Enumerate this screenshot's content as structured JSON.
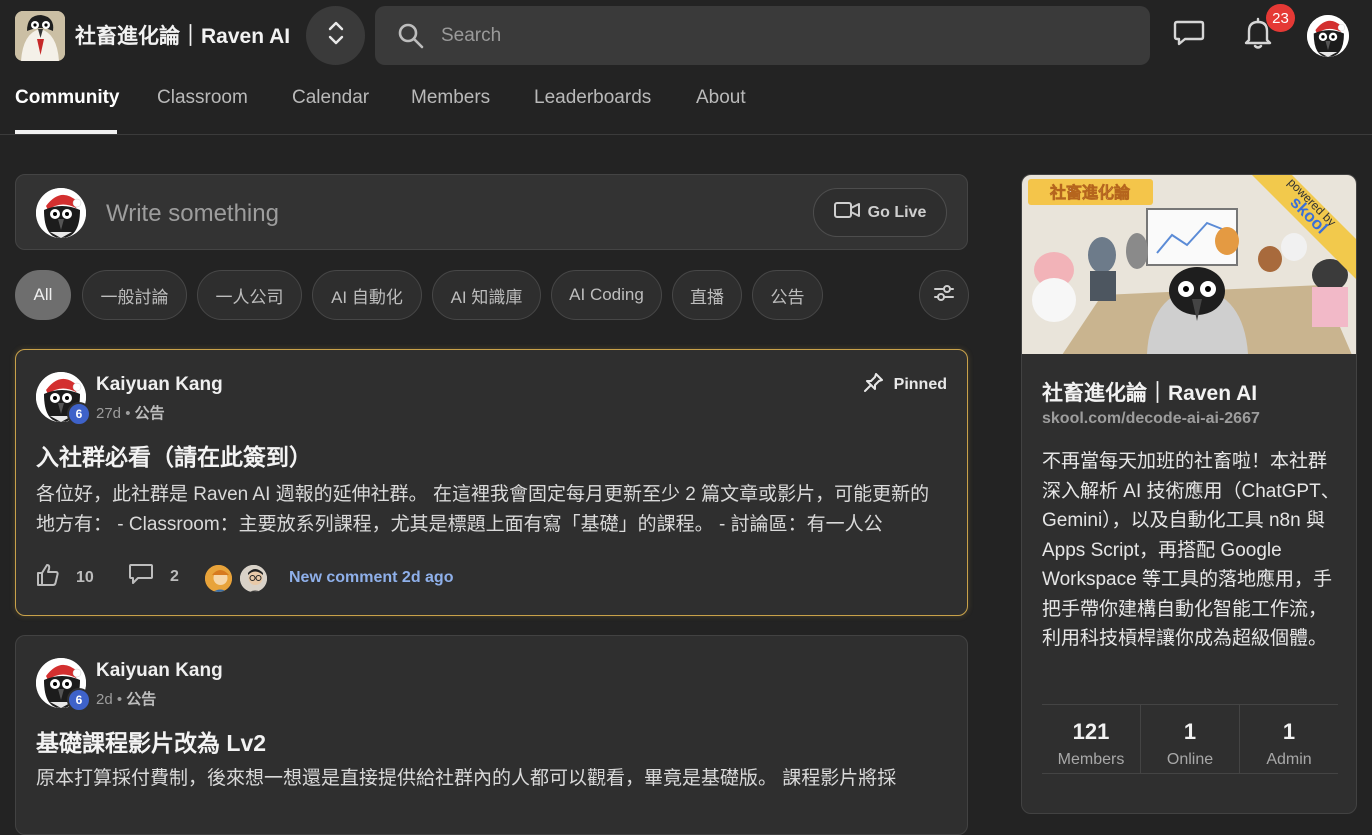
{
  "header": {
    "brand": "社畜進化論｜Raven AI",
    "search_placeholder": "Search",
    "notification_count": "23"
  },
  "nav": {
    "tabs": [
      {
        "label": "Community",
        "active": true
      },
      {
        "label": "Classroom"
      },
      {
        "label": "Calendar"
      },
      {
        "label": "Members"
      },
      {
        "label": "Leaderboards"
      },
      {
        "label": "About"
      }
    ]
  },
  "composer": {
    "placeholder": "Write something",
    "go_live_label": "Go Live"
  },
  "filters": {
    "chips": [
      "All",
      "一般討論",
      "一人公司",
      "AI 自動化",
      "AI 知識庫",
      "AI Coding",
      "直播",
      "公告"
    ],
    "active": "All"
  },
  "posts": [
    {
      "author": "Kaiyuan Kang",
      "level": "6",
      "age": "27d",
      "category": "公告",
      "pinned_label": "Pinned",
      "title": "入社群必看（請在此簽到）",
      "body": "各位好，此社群是 Raven AI 週報的延伸社群。 在這裡我會固定每月更新至少 2 篇文章或影片，可能更新的地方有： - Classroom：主要放系列課程，尤其是標題上面有寫「基礎」的課程。 - 討論區：有一人公",
      "likes": "10",
      "comments": "2",
      "new_comment": "New comment 2d ago"
    },
    {
      "author": "Kaiyuan Kang",
      "level": "6",
      "age": "2d",
      "category": "公告",
      "title": "基礎課程影片改為 Lv2",
      "body": "原本打算採付費制，後來想一想還是直接提供給社群內的人都可以觀看，畢竟是基礎版。 課程影片將採"
    }
  ],
  "sidebar": {
    "cover_text": "社畜進化論",
    "powered_by": "powered by",
    "powered_brand": "skool",
    "title": "社畜進化論｜Raven AI",
    "url": "skool.com/decode-ai-ai-2667",
    "description": "不再當每天加班的社畜啦！本社群深入解析 AI 技術應用（ChatGPT、Gemini），以及自動化工具 n8n 與 Apps Script，再搭配 Google Workspace 等工具的落地應用，手把手帶你建構自動化智能工作流，利用科技槓桿讓你成為超級個體。",
    "stats": [
      {
        "value": "121",
        "label": "Members"
      },
      {
        "value": "1",
        "label": "Online"
      },
      {
        "value": "1",
        "label": "Admin"
      }
    ]
  },
  "colors": {
    "background": "#232323",
    "card": "#2f2f2f",
    "pinned_border": "#c9a24a",
    "badge_red": "#e53935",
    "level_blue": "#3e62c9",
    "link_blue": "#8fb0ea"
  },
  "icons": [
    "swap-vertical-icon",
    "search-icon",
    "chat-icon",
    "bell-icon",
    "video-camera-icon",
    "sliders-icon",
    "pin-icon",
    "thumbs-up-icon",
    "comment-icon"
  ]
}
